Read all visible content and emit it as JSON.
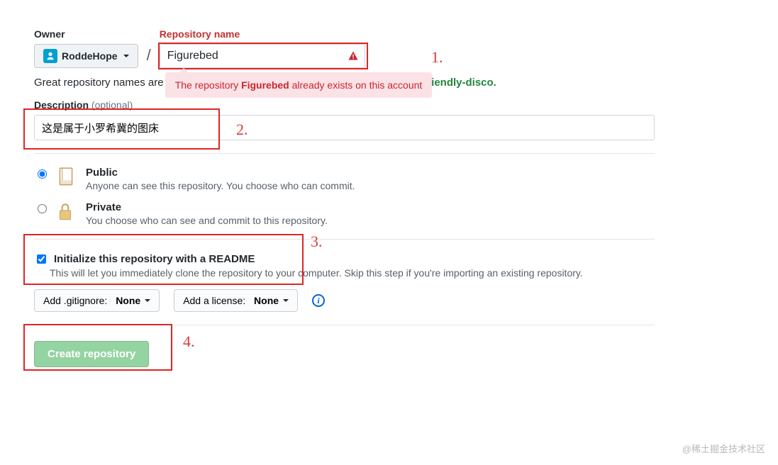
{
  "labels": {
    "owner": "Owner",
    "repo_name": "Repository name",
    "description": "Description",
    "optional": "(optional)"
  },
  "owner": {
    "username": "RoddeHope"
  },
  "repo": {
    "name_value": "Figurebed",
    "desc_value": "这是属于小罗希冀的图床"
  },
  "error": {
    "prefix": "The repository ",
    "name": "Figurebed",
    "suffix": " already exists on this account"
  },
  "hint": {
    "text": "Great repository names are",
    "suggestion": "friendly-disco."
  },
  "visibility": {
    "public": {
      "title": "Public",
      "sub": "Anyone can see this repository. You choose who can commit."
    },
    "private": {
      "title": "Private",
      "sub": "You choose who can see and commit to this repository."
    }
  },
  "readme": {
    "title": "Initialize this repository with a README",
    "sub": "This will let you immediately clone the repository to your computer. Skip this step if you're importing an existing repository."
  },
  "selects": {
    "gitignore_label": "Add .gitignore:",
    "gitignore_value": "None",
    "license_label": "Add a license:",
    "license_value": "None"
  },
  "buttons": {
    "create": "Create repository"
  },
  "annotations": {
    "a1": "1.",
    "a2": "2.",
    "a3": "3.",
    "a4": "4."
  },
  "watermark": "@稀土掘金技术社区"
}
